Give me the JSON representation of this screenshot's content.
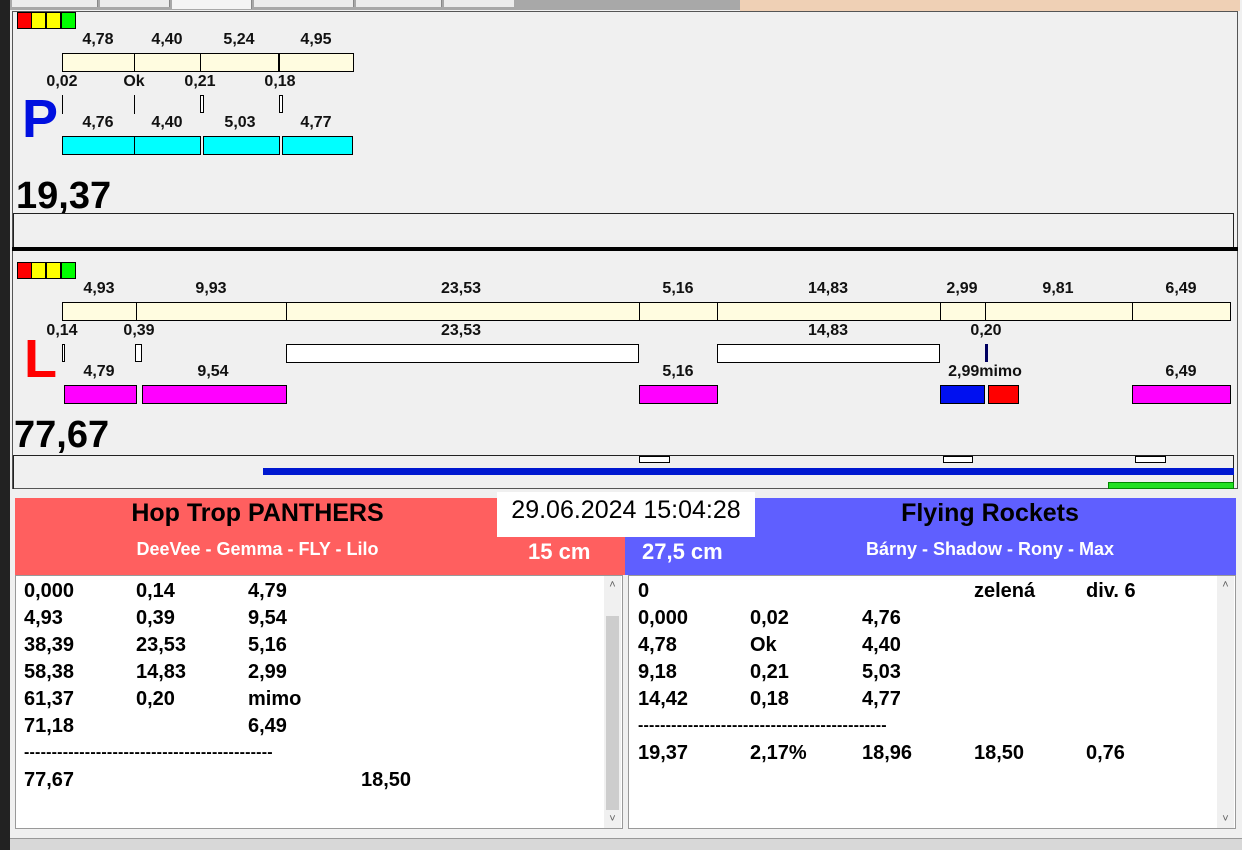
{
  "colors": {
    "cream": "#fffce0",
    "cyan": "#00ffff",
    "magenta": "#ff00ff",
    "home": "#ff5f5f",
    "guest": "#5f5fff"
  },
  "top_panel": {
    "letter": "P",
    "upper_labels": [
      "4,78",
      "4,40",
      "5,24",
      "4,95"
    ],
    "mid_labels": [
      "0,02",
      "Ok",
      "0,21",
      "0,18"
    ],
    "lower_labels": [
      "4,76",
      "4,40",
      "5,03",
      "4,77"
    ],
    "total": "19,37"
  },
  "bottom_panel": {
    "letter": "L",
    "upper_labels": [
      "4,93",
      "9,93",
      "23,53",
      "5,16",
      "14,83",
      "2,99",
      "9,81",
      "6,49"
    ],
    "mid_labels": [
      "0,14",
      "0,39",
      "23,53",
      "14,83",
      "0,20"
    ],
    "lower_labels": [
      "4,79",
      "9,54",
      "5,16",
      "2,99mimo",
      "6,49"
    ],
    "total": "77,67"
  },
  "datetime": "29.06.2024 15:04:28",
  "home": {
    "name": "Hop Trop PANTHERS",
    "dogs": "DeeVee - Gemma - FLY - Lilo",
    "height": "15 cm",
    "rows": [
      [
        "0,000",
        "0,14",
        "4,79"
      ],
      [
        "4,93",
        "0,39",
        "9,54"
      ],
      [
        "38,39",
        "23,53",
        "5,16"
      ],
      [
        "58,38",
        "14,83",
        "2,99"
      ],
      [
        "61,37",
        "0,20",
        "mimo"
      ],
      [
        "71,18",
        "",
        "6,49"
      ]
    ],
    "separator": "---------------------------------------------",
    "total": [
      "77,67",
      "18,50"
    ]
  },
  "guest": {
    "name": "Flying Rockets",
    "dogs": "Bárny - Shadow - Rony - Max",
    "height": "27,5 cm",
    "header": [
      "0",
      "zelená",
      "div. 6"
    ],
    "rows": [
      [
        "0,000",
        "0,02",
        "4,76"
      ],
      [
        "4,78",
        "Ok",
        "4,40"
      ],
      [
        "9,18",
        "0,21",
        "5,03"
      ],
      [
        "14,42",
        "0,18",
        "4,77"
      ]
    ],
    "separator": "---------------------------------------------",
    "total": [
      "19,37",
      "2,17%",
      "18,96",
      "18,50",
      "0,76"
    ]
  }
}
